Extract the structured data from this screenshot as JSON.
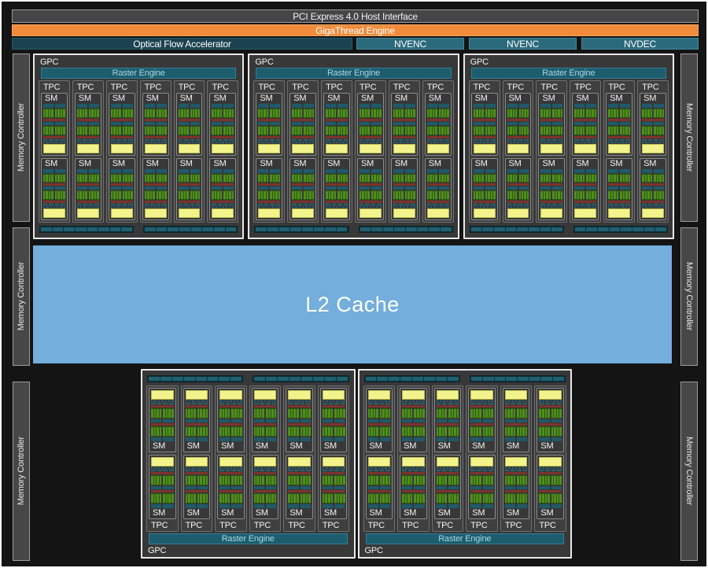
{
  "title_bars": {
    "pci": "PCI Express 4.0 Host Interface",
    "gigathread": "GigaThread Engine"
  },
  "media_engines": [
    {
      "label": "Optical Flow Accelerator",
      "variant": "dark"
    },
    {
      "label": "NVENC",
      "variant": "light"
    },
    {
      "label": "NVENC",
      "variant": "light"
    },
    {
      "label": "NVDEC",
      "variant": "light"
    }
  ],
  "memory_controller": {
    "label": "Memory Controller",
    "left_count": 3,
    "right_count": 3
  },
  "l2_cache": {
    "label": "L2 Cache"
  },
  "gpc": {
    "label": "GPC",
    "raster_engine_label": "Raster Engine",
    "tpc_label": "TPC",
    "sm_label": "SM",
    "top_count": 3,
    "bottom_count": 2,
    "tpcs_per_gpc": 6,
    "sms_per_tpc": 2,
    "rop_bars_per_gpc": 2,
    "rop_segments_per_bar": 8,
    "green_groups_per_row": 2,
    "strips_per_group": 4,
    "dash_row_segments": [
      4,
      7
    ]
  },
  "colors": {
    "background": "#141414",
    "gigathread_orange": "#f08b3c",
    "media_teal_dark": "#1b4250",
    "media_teal": "#2b6a7c",
    "raster_teal": "#1e5d6e",
    "sm_teal": "#1f5a69",
    "core_green": "#4f8f1e",
    "core_green_dark": "#2c5510",
    "tensor_red": "#7d332b",
    "cache_yellow": "#f2f38b",
    "l2_blue": "#73aedc",
    "panel_gray": "#454545"
  }
}
